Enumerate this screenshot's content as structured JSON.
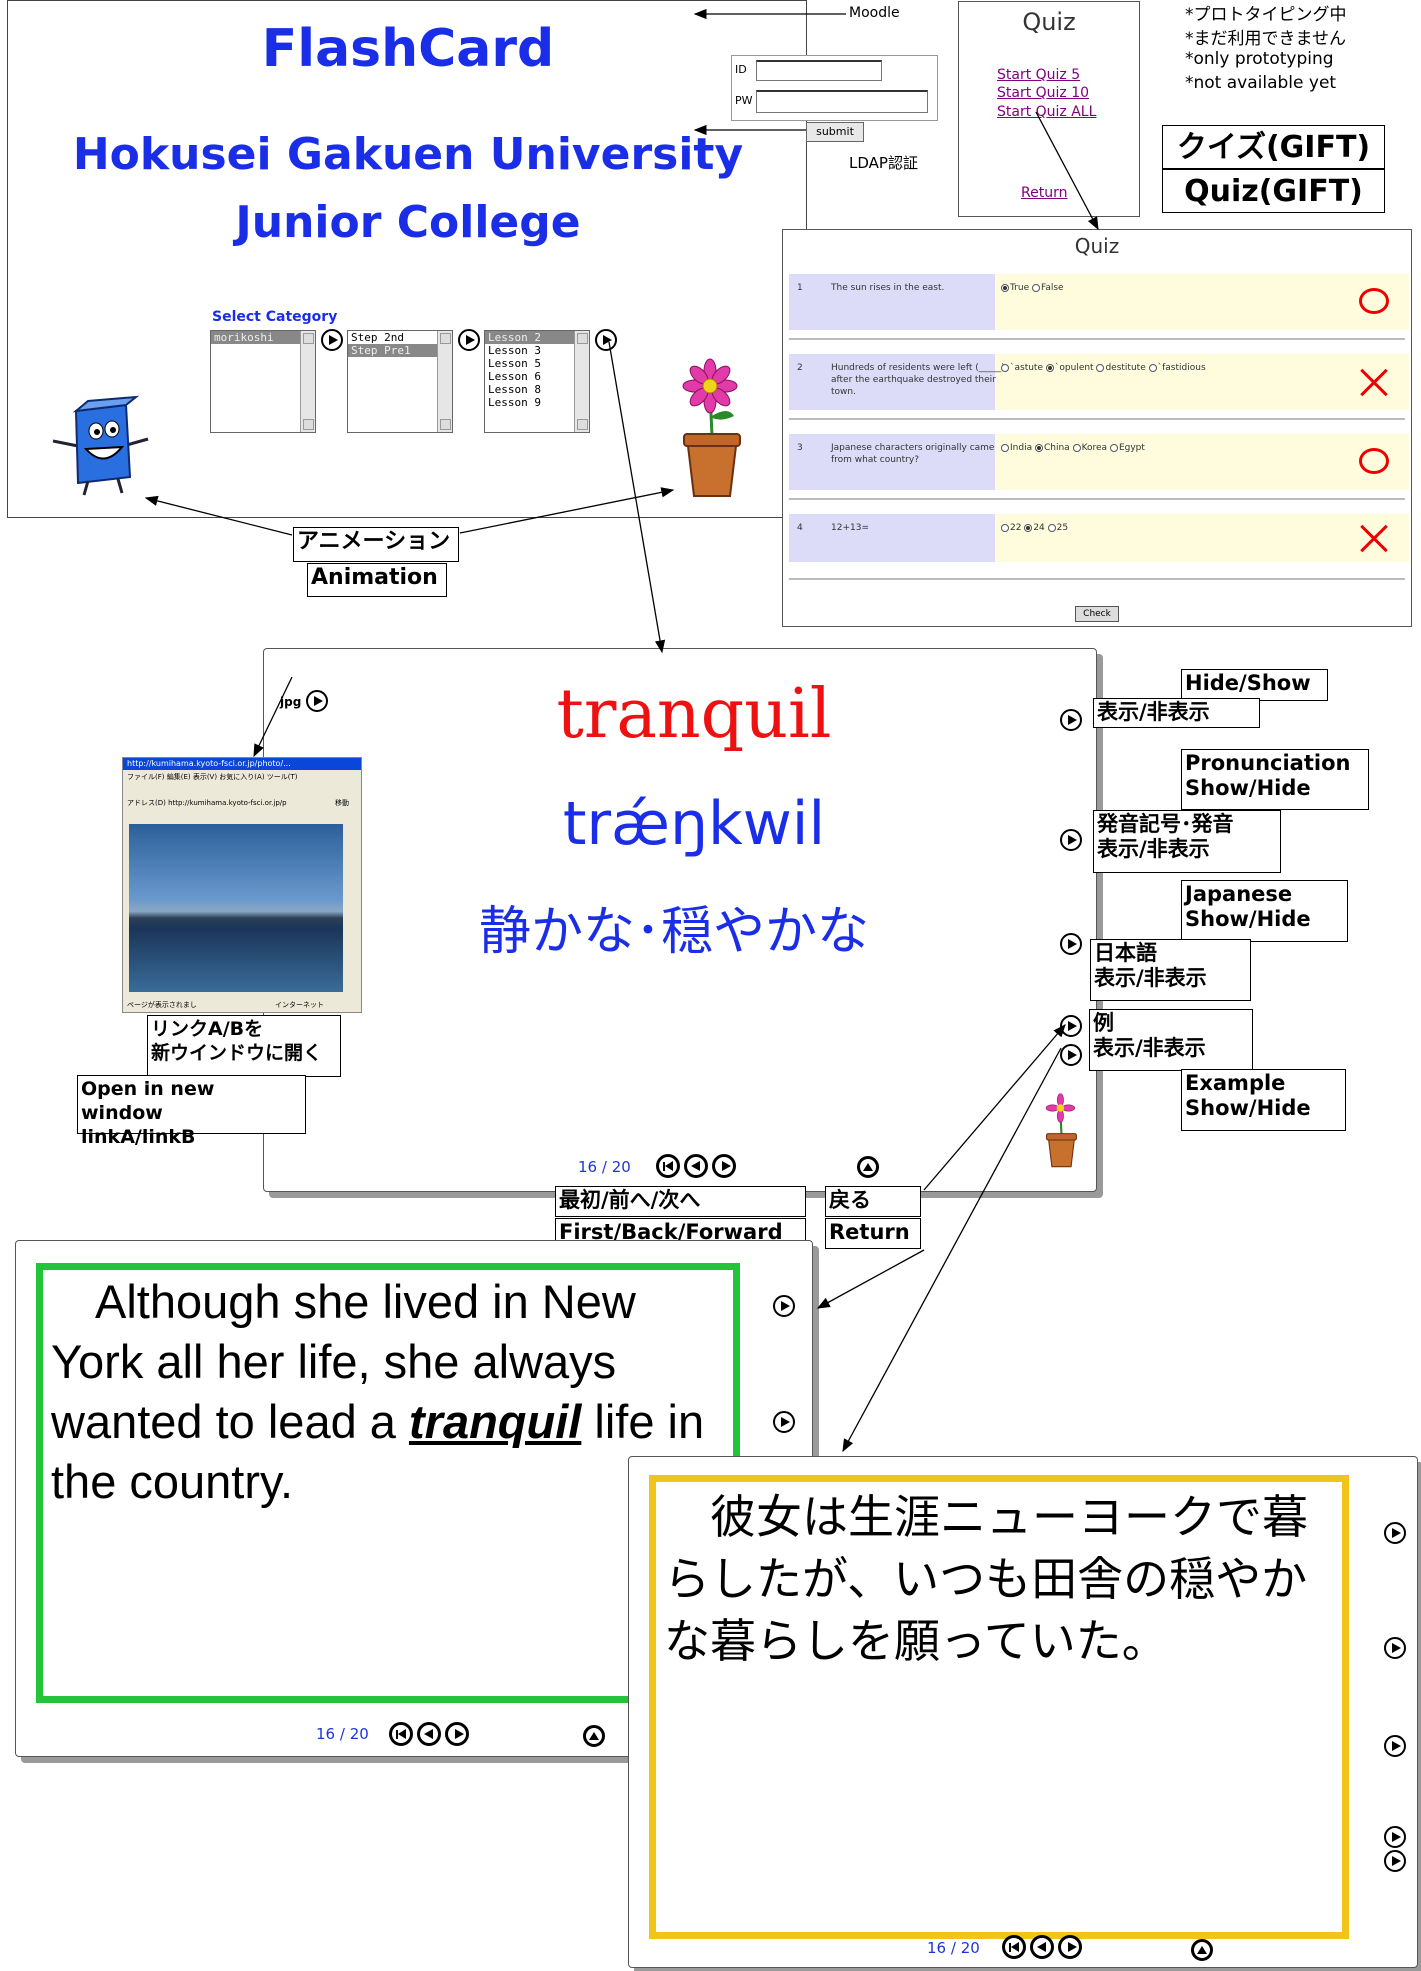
{
  "login_screen": {
    "title": "FlashCard",
    "university_line1": "Hokusei Gakuen University",
    "university_line2": "Junior College",
    "id_label": "ID",
    "pw_label": "PW",
    "submit_label": "submit",
    "select_category_label": "Select Category",
    "list1": [
      "morikoshi"
    ],
    "list2": [
      "Step 2nd",
      "Step Pre1"
    ],
    "list3": [
      "Lesson  2",
      "Lesson 3",
      "Lesson 5",
      "Lesson 6",
      "Lesson 8",
      "Lesson 9"
    ]
  },
  "annotations": {
    "moodle": "Moodle",
    "ldap": "LDAP認証",
    "proto_jp1": "*プロトタイピング中",
    "proto_jp2": "*まだ利用できません",
    "proto_en1": "*only prototyping",
    "proto_en2": "*not available yet",
    "gift_jp": "クイズ(GIFT)",
    "gift_en": "Quiz(GIFT)",
    "animation_jp": "アニメーション",
    "animation_en": "Animation",
    "hide_show": "Hide/Show",
    "hyoji_hihyoji": "表示/非表示",
    "pron_en": "Pronunciation\nShow/Hide",
    "pron_jp": "発音記号･発音\n表示/非表示",
    "jp_en": "Japanese\nShow/Hide",
    "jp_jp": "日本語\n表示/非表示",
    "ex_jp": "例\n表示/非表示",
    "ex_en": "Example\nShow/Hide",
    "link_jp": "リンクA/Bを\n新ウインドウに開く",
    "link_en": "Open in new window\nlinkA/linkB",
    "nav_jp": "最初/前へ/次へ",
    "nav_en": "First/Back/Forward",
    "return_jp": "戻る",
    "return_en": "Return",
    "jpg": "jpg"
  },
  "quiz_menu": {
    "title": "Quiz",
    "links": [
      "Start Quiz 5",
      "Start Quiz 10",
      "Start Quiz ALL"
    ],
    "return": "Return"
  },
  "quiz_panel": {
    "title": "Quiz",
    "questions": [
      {
        "num": "1",
        "text": "The sun rises in the east.",
        "options": [
          "True",
          "False"
        ],
        "selected": 0,
        "result": "correct"
      },
      {
        "num": "2",
        "text": "Hundreds of residents were left (_____)\nafter the earthquake destroyed their\ntown.",
        "options": [
          "`astute",
          "`opulent",
          "destitute",
          "`fastidious"
        ],
        "selected": 1,
        "result": "wrong"
      },
      {
        "num": "3",
        "text": "Japanese characters originally came\nfrom what country?",
        "options": [
          "India",
          "China",
          "Korea",
          "Egypt"
        ],
        "selected": 1,
        "result": "correct"
      },
      {
        "num": "4",
        "text": "12+13=",
        "options": [
          "22",
          "24",
          "25"
        ],
        "selected": 1,
        "result": "wrong"
      }
    ],
    "check_button": "Check"
  },
  "card": {
    "word": "tranquil",
    "phonetic": "trǽŋkwil",
    "japanese": "静かな･穏やかな",
    "counter_current": "16",
    "counter_total": "/ 20",
    "browser_title": "http://kumihama.kyoto-fsci.or.jp/photo/...",
    "browser_menu": "ファイル(F)  編集(E)  表示(V)  お気に入り(A)  ツール(T)",
    "browser_address": "アドレス(D)  http://kumihama.kyoto-fsci.or.jp/p",
    "browser_status": "ページが表示されまし",
    "browser_zone": "インターネット",
    "browser_go": "移動"
  },
  "example_card": {
    "text_before": "Although she lived in New York all her life, she always wanted to lead a ",
    "keyword": "tranquil",
    "text_after": " life in the country.",
    "counter_current": "16",
    "counter_total": "/ 20"
  },
  "japanese_card": {
    "text": "彼女は生涯ニューヨークで暮らしたが、いつも田舎の穏やかな暮らしを願っていた。",
    "counter_current": "16",
    "counter_total": "/ 20"
  },
  "colors": {
    "title_blue": "#1a2ee8",
    "word_red": "#ee1111",
    "counter_blue": "#1d35d8",
    "green_border": "#22c43a",
    "yellow_border": "#f0c419",
    "quiz_blue_cell": "#dcdcf8",
    "quiz_yellow_cell": "#fefcdc",
    "link_purple": "#800080"
  }
}
